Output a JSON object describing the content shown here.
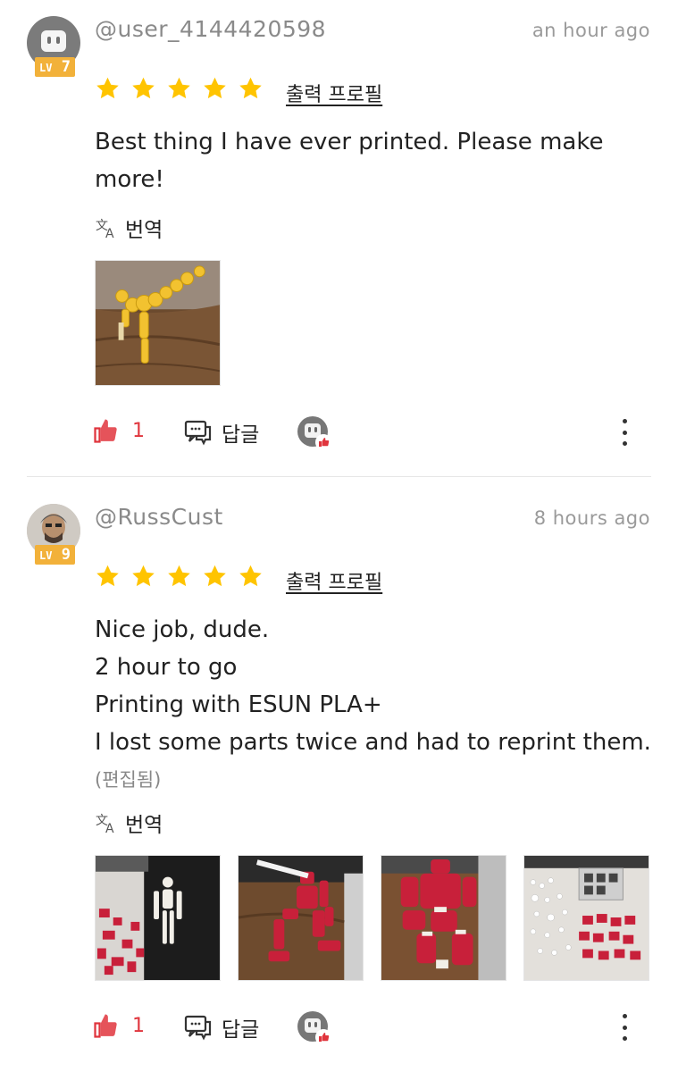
{
  "comments": [
    {
      "username": "@user_4144420598",
      "time": "an hour ago",
      "level_prefix": "LV",
      "level": "7",
      "rating": 5,
      "profile_link": "출력 프로필",
      "text_lines": [
        "Best thing I have ever printed. Please make",
        "more!"
      ],
      "edited": "",
      "translate_label": "번역",
      "like_count": "1",
      "reply_label": "답글",
      "images": [
        "yellow-figure-photo"
      ]
    },
    {
      "username": "@RussCust",
      "time": "8 hours ago",
      "level_prefix": "LV",
      "level": "9",
      "rating": 5,
      "profile_link": "출력 프로필",
      "text_lines": [
        "Nice job, dude.",
        "2 hour to go",
        "Printing with ESUN PLA+",
        "I lost some parts twice and had to reprint them."
      ],
      "edited": "(편집됨)",
      "translate_label": "번역",
      "like_count": "1",
      "reply_label": "답글",
      "images": [
        "white-figure-on-mat-photo",
        "red-figure-kneeling-photo",
        "red-figure-closeup-photo",
        "parts-layout-photo"
      ]
    }
  ],
  "colors": {
    "star": "#FFC400",
    "like": "#E0353D",
    "level_badge": "#F2B13A",
    "username": "#8A8A8A"
  }
}
